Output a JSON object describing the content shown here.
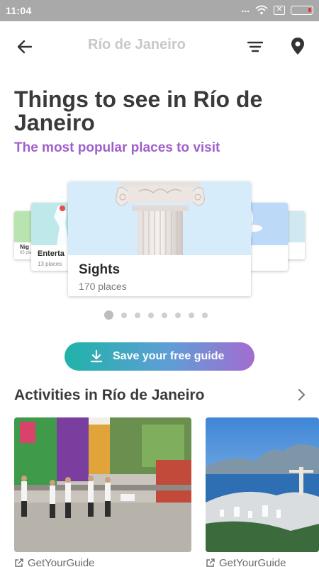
{
  "status_bar": {
    "time": "11:04",
    "dots": "...",
    "x_icon": "✕"
  },
  "header": {
    "title": "Río de Janeiro"
  },
  "hero": {
    "title": "Things to see in Río de Janeiro",
    "subtitle": "The most popular places to visit"
  },
  "carousel": {
    "far_left": {
      "label": "Nig",
      "count": "65 pla"
    },
    "left": {
      "label": "Enterta",
      "count": "13 places"
    },
    "center": {
      "label": "Sights",
      "count": "170 places"
    },
    "pages": 8,
    "active_page": 0
  },
  "save_button": {
    "label": "Save your free guide"
  },
  "activities": {
    "title": "Activities in Río de Janeiro",
    "items": [
      {
        "provider": "GetYourGuide"
      },
      {
        "provider": "GetYourGuide"
      }
    ]
  },
  "colors": {
    "accent_purple": "#a05fcb",
    "button_gradient_start": "#1fb3a8",
    "button_gradient_end": "#a36ccf",
    "status_bar": "#a9a9a9"
  },
  "icons": [
    "back-arrow-icon",
    "filter-icon",
    "location-pin-icon",
    "download-icon",
    "chevron-right-icon",
    "external-link-icon",
    "wifi-icon",
    "battery-icon"
  ]
}
